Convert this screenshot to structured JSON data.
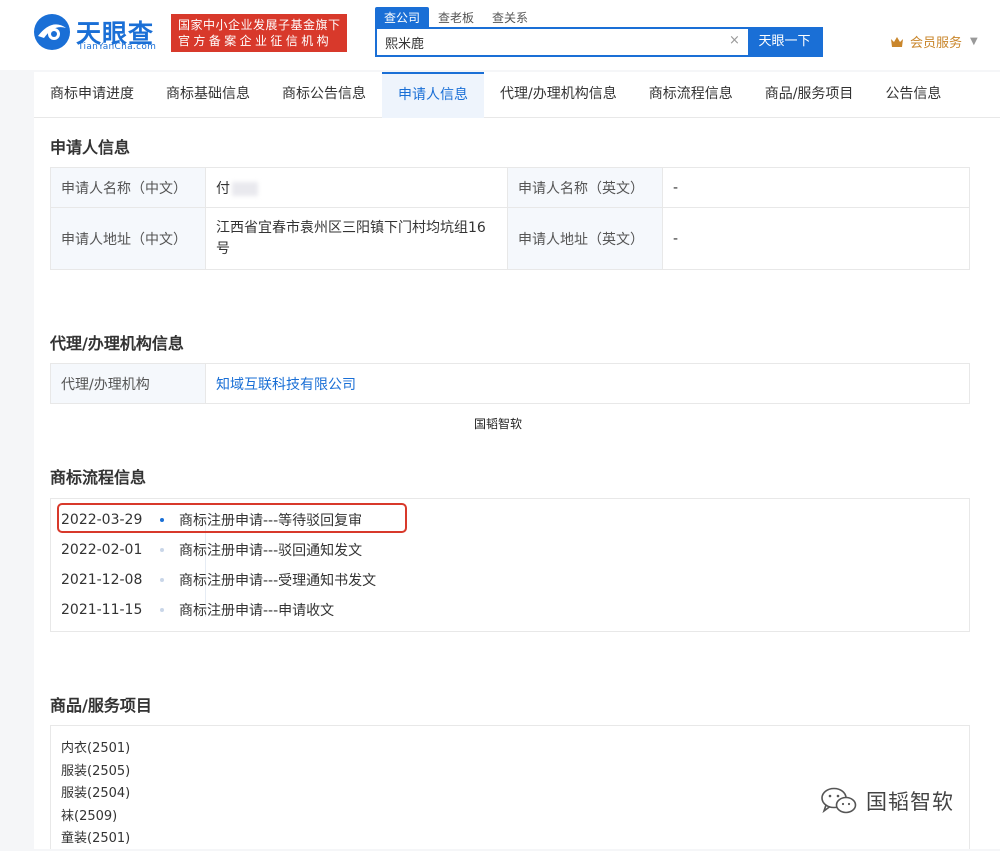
{
  "header": {
    "logo_text": "天眼查",
    "logo_sub": "TianYanCha.com",
    "badge_line1": "国家中小企业发展子基金旗下",
    "badge_line2": "官方备案企业征信机构",
    "search_tabs": [
      "查公司",
      "查老板",
      "查关系"
    ],
    "search_value": "熙米鹿",
    "search_clear": "×",
    "search_button": "天眼一下",
    "vip_label": "会员服务",
    "accent": "#1a6fd6",
    "badge_color": "#d8392b"
  },
  "tabs": [
    "商标申请进度",
    "商标基础信息",
    "商标公告信息",
    "申请人信息",
    "代理/办理机构信息",
    "商标流程信息",
    "商品/服务项目",
    "公告信息"
  ],
  "applicant": {
    "title": "申请人信息",
    "name_cn_label": "申请人名称（中文）",
    "name_cn_value": "付",
    "name_en_label": "申请人名称（英文）",
    "name_en_value": "-",
    "addr_cn_label": "申请人地址（中文）",
    "addr_cn_value_line1": "江西省宜春市袁州区三阳镇下门村均坑组16",
    "addr_cn_value_line2": "号",
    "addr_en_label": "申请人地址（英文）",
    "addr_en_value": "-"
  },
  "agency": {
    "title": "代理/办理机构信息",
    "label": "代理/办理机构",
    "value": "知域互联科技有限公司"
  },
  "watermark_center": "国韬智软",
  "flow": {
    "title": "商标流程信息",
    "items": [
      {
        "date": "2022-03-29",
        "text": "商标注册申请---等待驳回复审"
      },
      {
        "date": "2022-02-01",
        "text": "商标注册申请---驳回通知发文"
      },
      {
        "date": "2021-12-08",
        "text": "商标注册申请---受理通知书发文"
      },
      {
        "date": "2021-11-15",
        "text": "商标注册申请---申请收文"
      }
    ]
  },
  "goods": {
    "title": "商品/服务项目",
    "items": [
      "内衣(2501)",
      "服装(2505)",
      "服装(2504)",
      "袜(2509)",
      "童装(2501)"
    ]
  },
  "watermark_brand": "国韬智软"
}
